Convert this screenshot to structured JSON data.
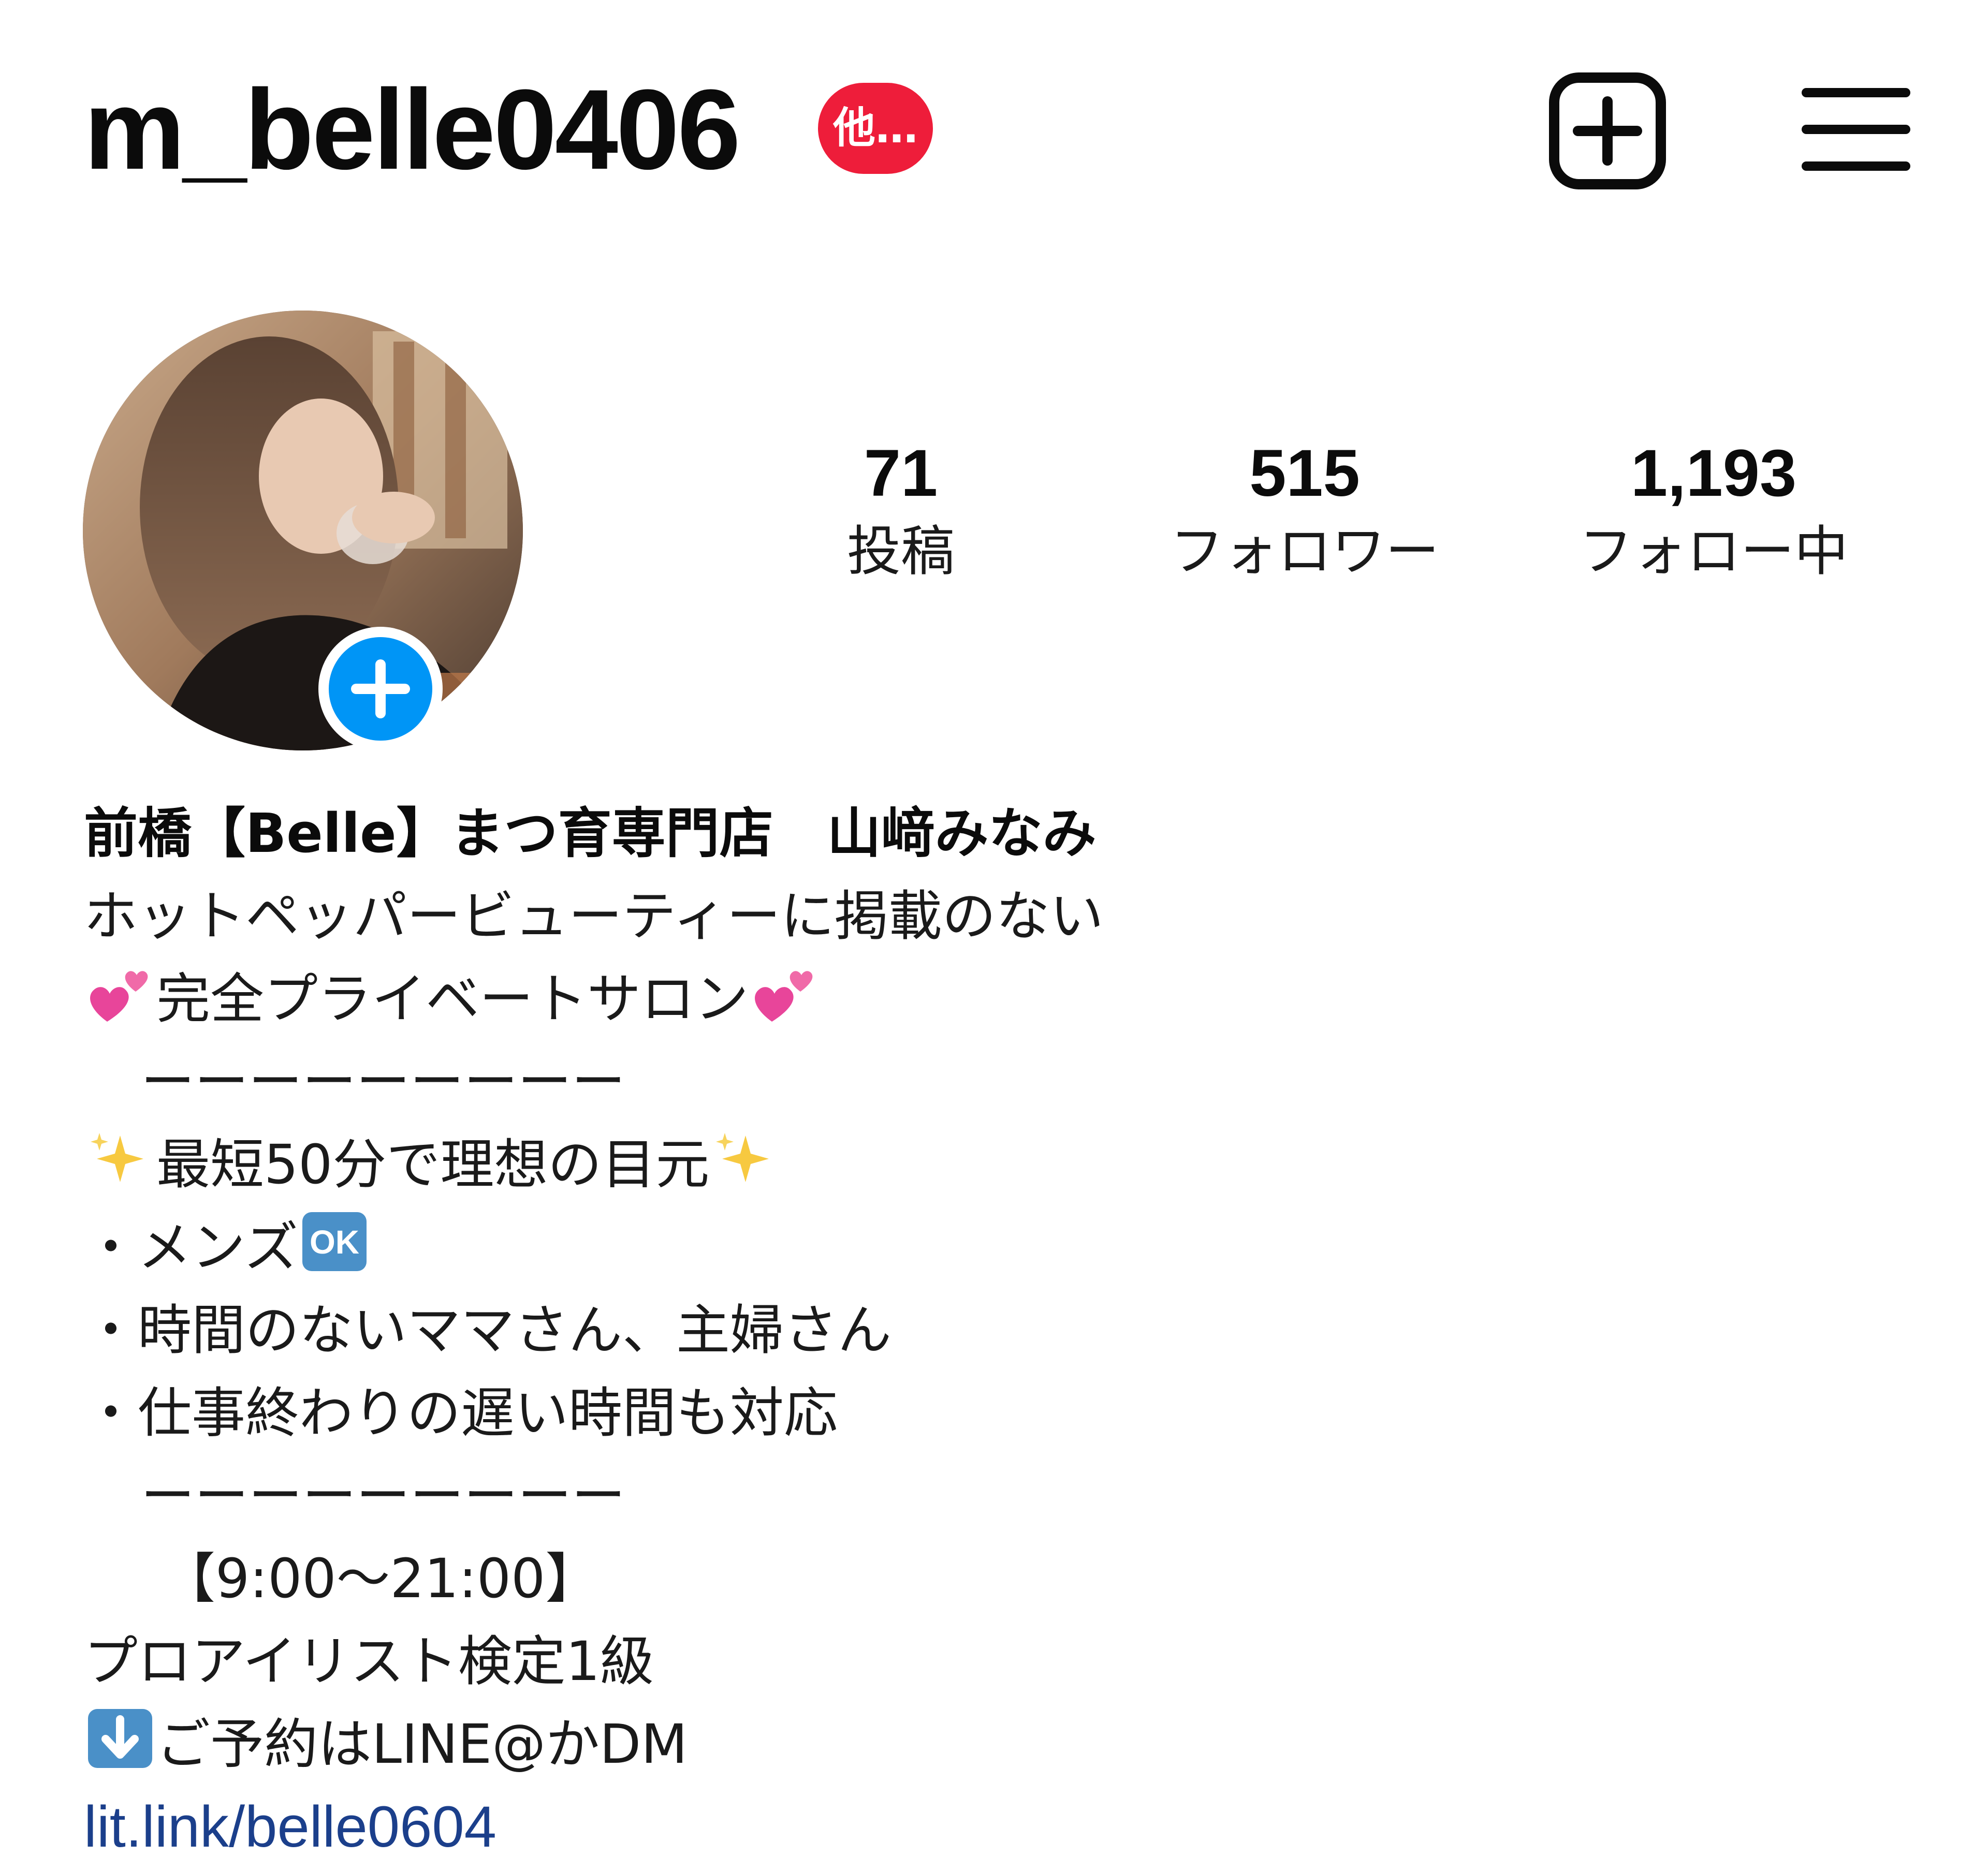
{
  "header": {
    "username": "m_belle0406",
    "badge_text": "他…",
    "new_post_icon": "plus-square-icon",
    "menu_icon": "hamburger-menu-icon"
  },
  "profile": {
    "avatar_icon": "profile-photo",
    "add_story_icon": "plus-circle-icon"
  },
  "stats": [
    {
      "value": "71",
      "label": "投稿"
    },
    {
      "value": "515",
      "label": "フォロワー"
    },
    {
      "value": "1,193",
      "label": "フォロー中"
    }
  ],
  "bio": {
    "name": "前橋【Belle】まつ育専門店　山﨑みなみ",
    "line1": "ホットペッパービューティーに掲載のない",
    "line2": "完全プライベートサロン",
    "divider1": "ーーーーーーーーー",
    "line3": "最短50分で理想の目元",
    "bullet1": "・メンズ",
    "bullet2": "・時間のないママさん、主婦さん",
    "bullet3": "・仕事終わりの遅い時間も対応",
    "divider2": "ーーーーーーーーー",
    "hours": "【9:00～21:00】",
    "cert": "プロアイリスト検定1級",
    "booking": "ご予約はLINE@かDM",
    "link": "lit.link/belle0604"
  },
  "colors": {
    "accent_blue": "#0095f6",
    "badge_red": "#ee1d3a",
    "link_blue": "#1b3f8b"
  }
}
